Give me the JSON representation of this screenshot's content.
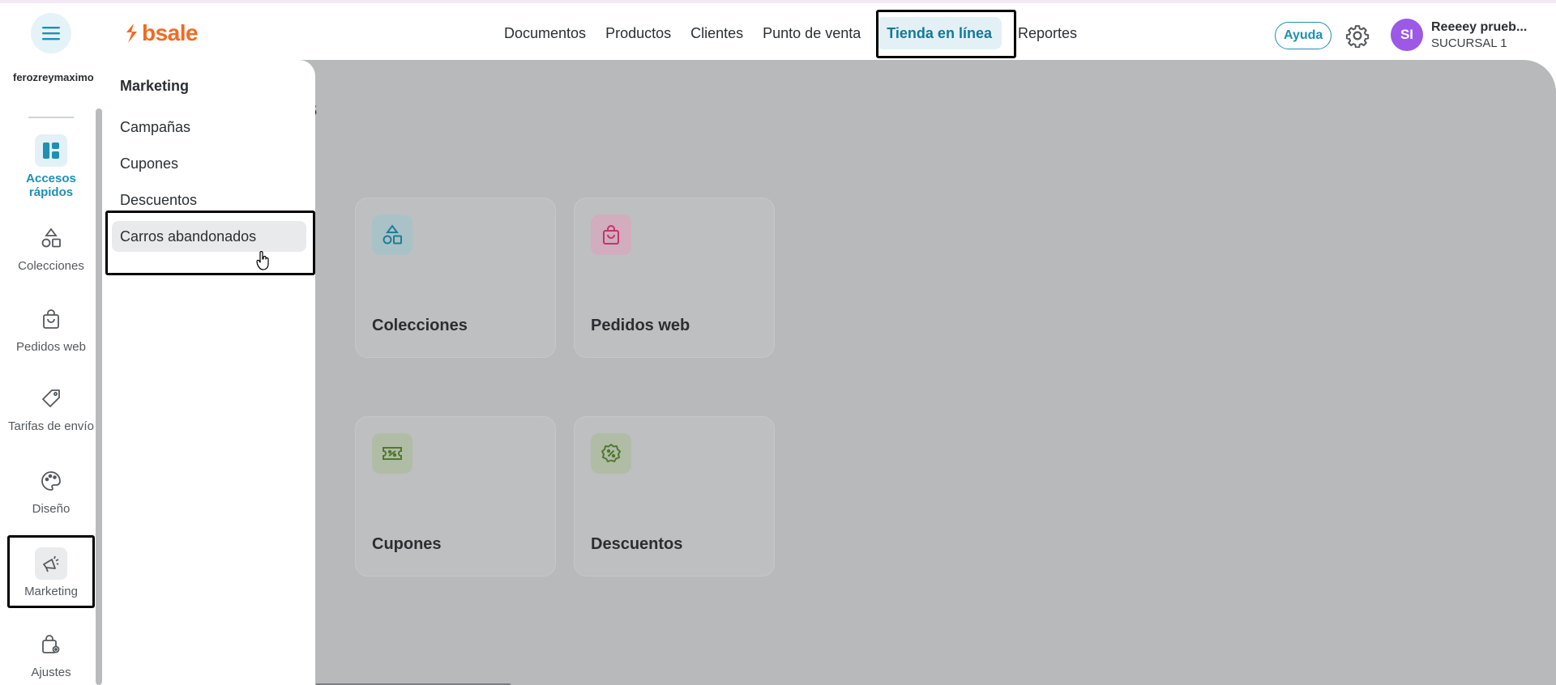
{
  "header": {
    "logo": "bsale",
    "nav": [
      "Documentos",
      "Productos",
      "Clientes",
      "Punto de venta",
      "Tienda en línea",
      "Reportes"
    ],
    "active_nav": "Tienda en línea",
    "help": "Ayuda",
    "user": {
      "initials": "SI",
      "name": "Reeeey prueb...",
      "branch": "SUCURSAL 1"
    }
  },
  "rail": {
    "store": "ferozreymaximo",
    "items": [
      {
        "label": "Accesos rápidos",
        "icon": "dashboard-icon"
      },
      {
        "label": "Colecciones",
        "icon": "shapes-icon"
      },
      {
        "label": "Pedidos web",
        "icon": "bag-icon"
      },
      {
        "label": "Tarifas de envío",
        "icon": "tag-icon"
      },
      {
        "label": "Diseño",
        "icon": "palette-icon"
      },
      {
        "label": "Marketing",
        "icon": "megaphone-icon"
      },
      {
        "label": "Ajustes",
        "icon": "bag-gear-icon"
      }
    ]
  },
  "main": {
    "title_fragment": "s",
    "cards": [
      {
        "title": "Colecciones",
        "icon": "shapes-icon",
        "color": "#1f7e93"
      },
      {
        "title": "Pedidos web",
        "icon": "bag-icon",
        "color": "#c2356f"
      },
      {
        "title": "Cupones",
        "icon": "coupon-icon",
        "color": "#4e7a2c"
      },
      {
        "title": "Descuentos",
        "icon": "discount-badge-icon",
        "color": "#4e7a2c"
      }
    ]
  },
  "submenu": {
    "title": "Marketing",
    "items": [
      "Campañas",
      "Cupones",
      "Descuentos",
      "Carros abandonados"
    ]
  }
}
